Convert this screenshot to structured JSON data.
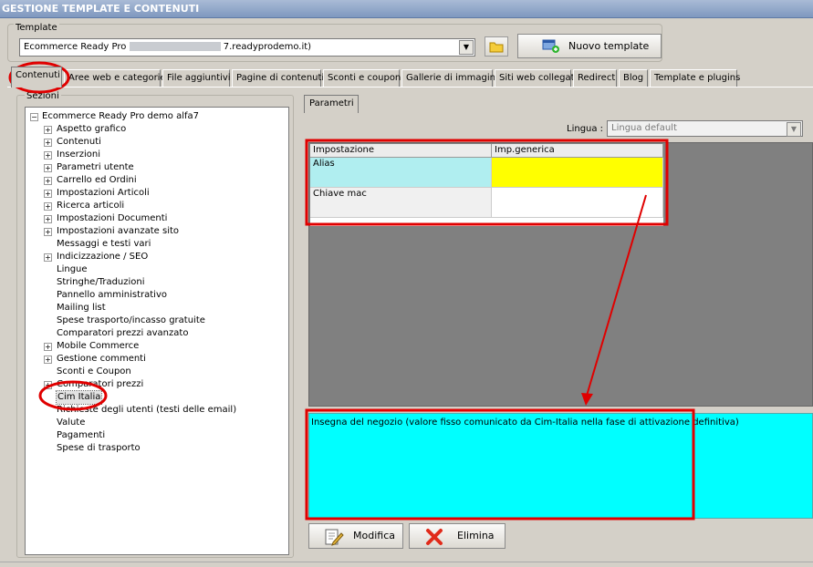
{
  "window": {
    "title": "GESTIONE TEMPLATE E CONTENUTI"
  },
  "template": {
    "group_label": "Template",
    "selected_prefix": "Ecommerce Ready Pro",
    "selected_suffix": "7.readyprodemo.it)",
    "new_button": "Nuovo template",
    "folder_icon": "folder-icon",
    "new_icon": "new-template-icon"
  },
  "tabs": [
    "Contenuti",
    "Aree web e categorie",
    "File aggiuntivi",
    "Pagine di contenuti",
    "Sconti e coupon",
    "Gallerie di immagini",
    "Siti web collegati",
    "Redirect",
    "Blog",
    "Template e plugins"
  ],
  "sections": {
    "label": "Sezioni",
    "root": "Ecommerce Ready Pro demo alfa7",
    "items": [
      {
        "label": "Aspetto grafico",
        "expandable": true
      },
      {
        "label": "Contenuti",
        "expandable": true
      },
      {
        "label": "Inserzioni",
        "expandable": true
      },
      {
        "label": "Parametri utente",
        "expandable": true
      },
      {
        "label": "Carrello ed Ordini",
        "expandable": true
      },
      {
        "label": "Impostazioni Articoli",
        "expandable": true
      },
      {
        "label": "Ricerca articoli",
        "expandable": true
      },
      {
        "label": "Impostazioni Documenti",
        "expandable": true
      },
      {
        "label": "Impostazioni avanzate sito",
        "expandable": true
      },
      {
        "label": "Messaggi e testi vari",
        "expandable": false
      },
      {
        "label": "Indicizzazione / SEO",
        "expandable": true
      },
      {
        "label": "Lingue",
        "expandable": false
      },
      {
        "label": "Stringhe/Traduzioni",
        "expandable": false
      },
      {
        "label": "Pannello amministrativo",
        "expandable": false
      },
      {
        "label": "Mailing list",
        "expandable": false
      },
      {
        "label": "Spese trasporto/incasso gratuite",
        "expandable": false
      },
      {
        "label": "Comparatori prezzi avanzato",
        "expandable": false
      },
      {
        "label": "Mobile Commerce",
        "expandable": true
      },
      {
        "label": "Gestione commenti",
        "expandable": true
      },
      {
        "label": "Sconti e Coupon",
        "expandable": false
      },
      {
        "label": "Comparatori prezzi",
        "expandable": true
      },
      {
        "label": "Cim Italia",
        "expandable": false,
        "selected": true
      },
      {
        "label": "Richieste degli utenti (testi delle email)",
        "expandable": false
      },
      {
        "label": "Valute",
        "expandable": false
      },
      {
        "label": "Pagamenti",
        "expandable": false
      },
      {
        "label": "Spese di trasporto",
        "expandable": false
      }
    ]
  },
  "params": {
    "tab_label": "Parametri",
    "lingua_label": "Lingua :",
    "lingua_value": "Lingua default",
    "columns": [
      "Impostazione",
      "Imp.generica"
    ],
    "rows": [
      {
        "name": "Alias",
        "value": ""
      },
      {
        "name": "Chiave mac",
        "value": ""
      }
    ],
    "description": "Insegna del negozio (valore fisso comunicato da Cim-Italia nella fase di attivazione definitiva)",
    "modify_button": "Modifica",
    "delete_button": "Elimina"
  },
  "colors": {
    "highlight_red": "#e00000",
    "description_bg": "#00ffff",
    "alias_row_bg": "#b0eef0",
    "value_cell_bg": "#ffff00"
  }
}
